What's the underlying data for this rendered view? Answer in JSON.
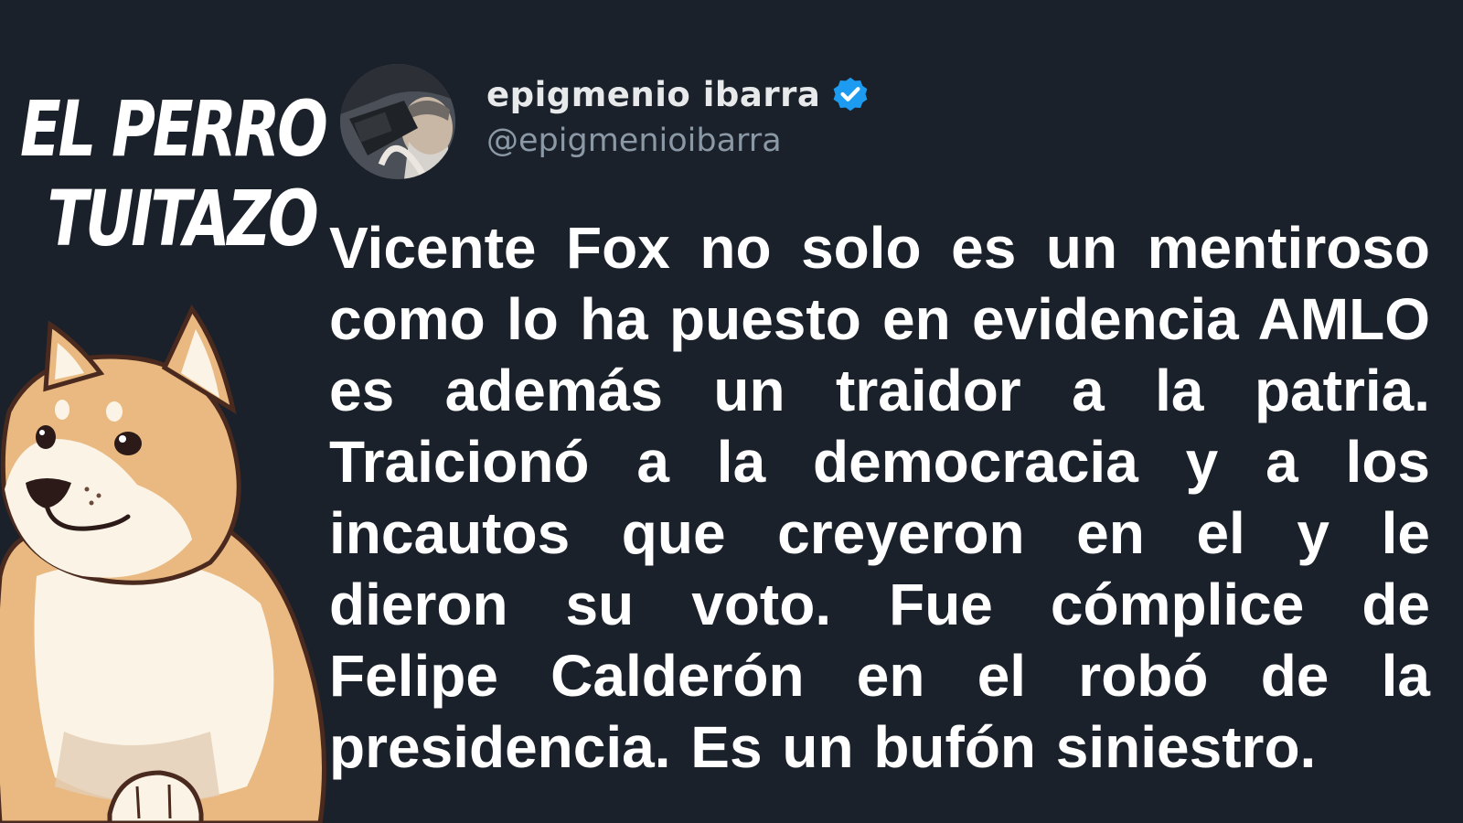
{
  "brand": {
    "line1": "EL PERRO",
    "line2": "TUITAZO"
  },
  "user": {
    "display_name": "epigmenio ibarra",
    "handle": "@epigmenioibarra",
    "verified_color": "#1d9bf0"
  },
  "tweet": {
    "text": "Vicente Fox no solo es un mentiroso como lo ha puesto en evidencia AMLO es además un traidor a la patria. Traicionó a la democracia y a los incautos que creyeron en el y le dieron su voto. Fue cómplice de Felipe Calderón en el robó de la presidencia. Es un bufón siniestro."
  },
  "colors": {
    "background": "#1a212b",
    "text": "#ffffff",
    "handle": "#8b98a5"
  },
  "icons": {
    "verified": "verified-badge-icon",
    "mascot": "shiba-dog-illustration"
  }
}
